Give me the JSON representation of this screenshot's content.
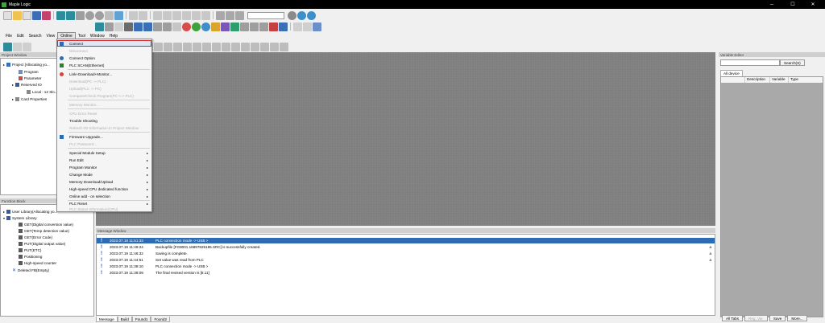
{
  "app": {
    "title": "Maple Logic"
  },
  "window_controls": {
    "minimize": "─",
    "maximize": "☐",
    "close": "✕"
  },
  "menubar": [
    {
      "label": "File"
    },
    {
      "label": "Edit"
    },
    {
      "label": "Search"
    },
    {
      "label": "View"
    },
    {
      "label": "Online",
      "active": true
    },
    {
      "label": "Tool"
    },
    {
      "label": "Window"
    },
    {
      "label": "Help"
    }
  ],
  "online_menu": {
    "items": [
      {
        "label": "Connect",
        "highlighted": true,
        "icon": "connect-icon"
      },
      {
        "label": "Disconnect",
        "disabled": true
      },
      {
        "label": "Connect Option",
        "icon": "connect-option-icon"
      },
      {
        "label": "PLC SCAN(Ethernet)",
        "icon": "plc-scan-icon"
      },
      {
        "sep": true
      },
      {
        "label": "Link+Download+Monitor...",
        "icon": "link-download-icon"
      },
      {
        "label": "Download(PC -> PLC)",
        "disabled": true
      },
      {
        "label": "Upload(PLC -> PC)",
        "disabled": true
      },
      {
        "label": "Compare/Check Program(PC <-> PLC)",
        "disabled": true
      },
      {
        "sep": true
      },
      {
        "label": "Memory Monitor...",
        "disabled": true
      },
      {
        "sep": true
      },
      {
        "label": "CPU Error Reset",
        "disabled": true
      },
      {
        "label": "Trouble Shooting"
      },
      {
        "label": "Refresh I/O Information In Project Window",
        "disabled": true
      },
      {
        "sep": true
      },
      {
        "label": "Firmware Upgrade...",
        "icon": "firmware-icon"
      },
      {
        "label": "PLC Password...",
        "disabled": true
      },
      {
        "sep": true
      },
      {
        "label": "Special Module Setup",
        "submenu": true
      },
      {
        "label": "Run Edit",
        "submenu": true
      },
      {
        "label": "Program Monitor",
        "submenu": true
      },
      {
        "label": "Change Mode",
        "submenu": true
      },
      {
        "label": "Memory Download/Upload",
        "submenu": true
      },
      {
        "label": "High-speed CPU dedicated function",
        "submenu": true
      },
      {
        "label": "Online add - on selection",
        "submenu": true
      },
      {
        "sep": true
      },
      {
        "label": "PLC Reset",
        "submenu": true
      },
      {
        "label": "PLC Status Information(CPU)",
        "disabled": true
      }
    ]
  },
  "project_window": {
    "header": "Project Window",
    "items": [
      {
        "label": "Project [Allocating yo...",
        "level": 0,
        "icon": "project-icon"
      },
      {
        "label": "Program",
        "level": 1,
        "icon": "program-icon"
      },
      {
        "label": "Parameter",
        "level": 1,
        "icon": "parameter-icon"
      },
      {
        "label": "Reserved IO",
        "level": 1,
        "icon": "reserved-io-icon"
      },
      {
        "label": "Local : 12 Slo...",
        "level": 2,
        "icon": "local-slot-icon"
      },
      {
        "label": "Card Properties",
        "level": 1,
        "icon": "card-properties-icon"
      }
    ]
  },
  "function_block": {
    "header": "Function Block",
    "items": [
      {
        "label": "User Library(Allocating yo...",
        "level": 0
      },
      {
        "label": "System Library",
        "level": 0
      },
      {
        "label": "GET(Digital conversion value)",
        "level": 1
      },
      {
        "label": "GET(Temp detection value)",
        "level": 1
      },
      {
        "label": "GET(Error Code)",
        "level": 1
      },
      {
        "label": "PUT(Digital output value)",
        "level": 1
      },
      {
        "label": "PUT(ETC)",
        "level": 1
      },
      {
        "label": "Positioning",
        "level": 1
      },
      {
        "label": "High-speed counter",
        "level": 1
      },
      {
        "label": "Deleted FB(Empty)",
        "level": 0
      }
    ]
  },
  "message_window": {
    "header": "Message Window",
    "rows": [
      {
        "time": "2023.07.19 11:51:33",
        "text": "PLC connection mode -> USB >",
        "right": "",
        "selected": true
      },
      {
        "time": "2023.07.19 11:49:24",
        "text": "Backupfile [FG8001.16897825185.SRC] is successfully created.",
        "right": "a"
      },
      {
        "time": "2023.07.19 11:46:32",
        "text": "Saving is complete.",
        "right": "a"
      },
      {
        "time": "2023.07.19 11:44:51",
        "text": "Set value was read from PLC",
        "right": "a"
      },
      {
        "time": "2023.07.19 11:38:10",
        "text": "PLC connection mode -> USB >",
        "right": ""
      },
      {
        "time": "2023.07.19 11:38:09",
        "text": "The final revised version is [8.11]",
        "right": ""
      }
    ],
    "tabs": [
      {
        "label": "Message",
        "active": true
      },
      {
        "label": "Build"
      },
      {
        "label": "Found1"
      },
      {
        "label": "Found2"
      }
    ]
  },
  "variable_editor": {
    "header": "Variable Editor",
    "search_label": "Search(S)",
    "tab": "All device",
    "columns": [
      "",
      "Description",
      "Variable",
      "Type"
    ],
    "buttons": [
      {
        "label": "All Tabs"
      },
      {
        "label": "Reg. Var.",
        "disabled": true
      },
      {
        "label": "Save"
      },
      {
        "label": "More..."
      }
    ]
  }
}
